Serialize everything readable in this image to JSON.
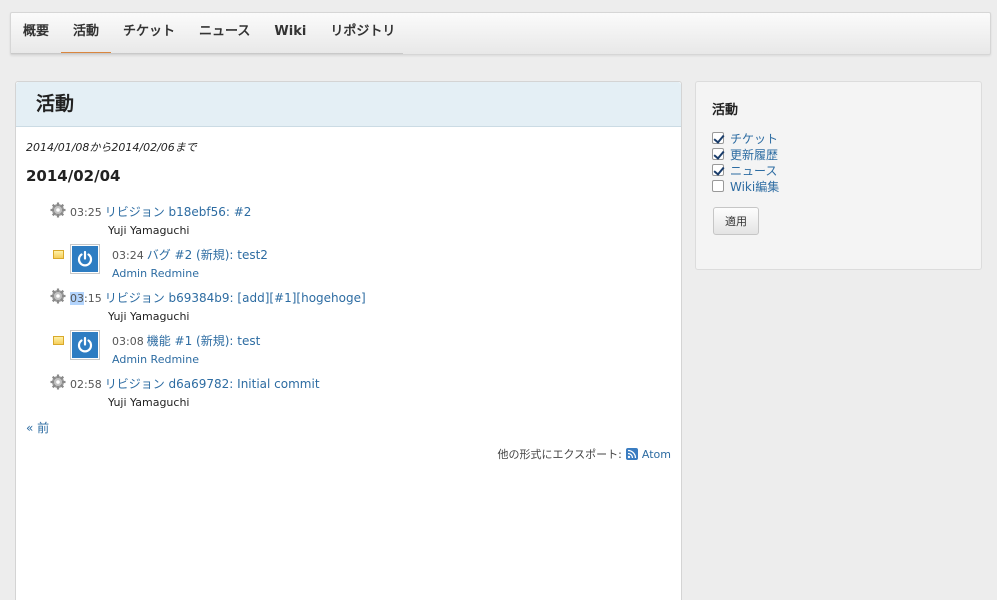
{
  "tabs": [
    {
      "label": "概要"
    },
    {
      "label": "活動"
    },
    {
      "label": "チケット"
    },
    {
      "label": "ニュース"
    },
    {
      "label": "Wiki"
    },
    {
      "label": "リポジトリ"
    }
  ],
  "active_tab": "活動",
  "main": {
    "title": "活動",
    "range": "2014/01/08から2014/02/06まで",
    "date": "2014/02/04",
    "entries": [
      {
        "type": "changeset",
        "time": "03:25",
        "title": "リビジョン b18ebf56: #2",
        "author": "Yuji Yamaguchi"
      },
      {
        "type": "issue",
        "time": "03:24",
        "title": "バグ #2 (新規): test2",
        "author": "Admin Redmine"
      },
      {
        "type": "changeset",
        "time_selected": "03",
        "time_rest": ":15",
        "title": "リビジョン b69384b9: [add][#1][hogehoge]",
        "author": "Yuji Yamaguchi"
      },
      {
        "type": "issue",
        "time": "03:08",
        "title": "機能 #1 (新規): test",
        "author": "Admin Redmine"
      },
      {
        "type": "changeset",
        "time": "02:58",
        "title": "リビジョン d6a69782: Initial commit",
        "author": "Yuji Yamaguchi"
      }
    ],
    "prev_link": "« 前",
    "export_label": "他の形式にエクスポート:",
    "export_atom": "Atom"
  },
  "sidebar": {
    "title": "活動",
    "filters": [
      {
        "label": "チケット",
        "checked": true
      },
      {
        "label": "更新履歴",
        "checked": true
      },
      {
        "label": "ニュース",
        "checked": true
      },
      {
        "label": "Wiki編集",
        "checked": false
      }
    ],
    "apply_label": "適用"
  }
}
